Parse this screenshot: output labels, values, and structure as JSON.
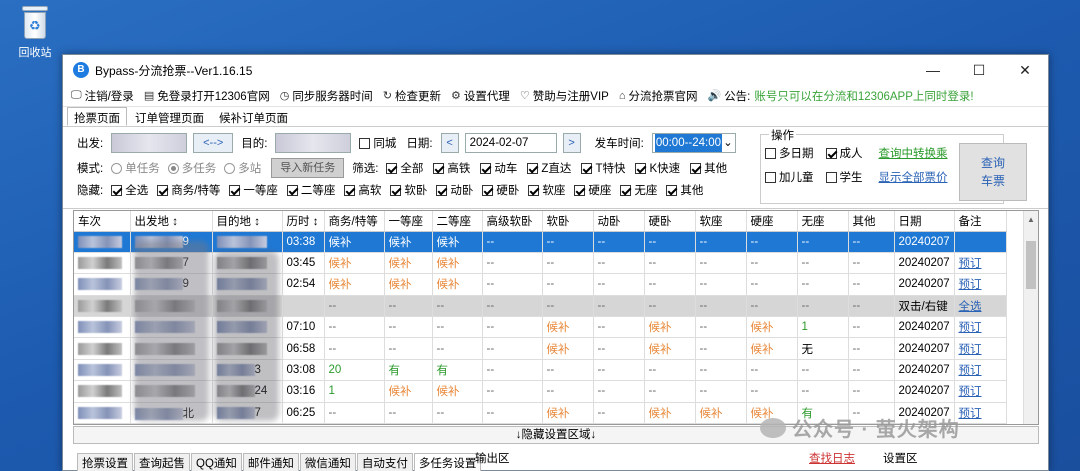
{
  "desktop": {
    "recycle_bin_label": "回收站"
  },
  "window": {
    "title": "Bypass-分流抢票--Ver1.16.15",
    "min": "—",
    "max": "☐",
    "close": "✕"
  },
  "menu": {
    "items": [
      {
        "icon": "🖵",
        "label": "注销/登录"
      },
      {
        "icon": "▤",
        "label": "免登录打开12306官网"
      },
      {
        "icon": "◷",
        "label": "同步服务器时间"
      },
      {
        "icon": "↻",
        "label": "检查更新"
      },
      {
        "icon": "⚙",
        "label": "设置代理"
      },
      {
        "icon": "♡",
        "label": "赞助与注册VIP"
      },
      {
        "icon": "⌂",
        "label": "分流抢票官网"
      },
      {
        "icon": "🔊",
        "label": "公告:"
      }
    ],
    "notice": "账号只可以在分流和12306APP上同时登录!"
  },
  "tabs": [
    "抢票页面",
    "订单管理页面",
    "候补订单页面"
  ],
  "query": {
    "from_label": "出发:",
    "swap": "<-->",
    "to_label": "目的:",
    "same_city": "同城",
    "date_label": "日期:",
    "date": "2024-02-07",
    "prev": "<",
    "next": ">",
    "time_label": "发车时间:",
    "time": "00:00--24:00",
    "mode_label": "模式:",
    "mode_single": "单任务",
    "mode_multi": "多任务",
    "mode_multi_station": "多站",
    "import_btn": "导入新任务",
    "filter_label": "筛选:",
    "filters": [
      "全部",
      "高铁",
      "动车",
      "Z直达",
      "T特快",
      "K快速",
      "其他"
    ],
    "hide_label": "隐藏:",
    "hides": [
      "全选",
      "商务/特等",
      "一等座",
      "二等座",
      "高软",
      "软卧",
      "动卧",
      "硬卧",
      "软座",
      "硬座",
      "无座",
      "其他"
    ]
  },
  "ops": {
    "title": "操作",
    "multi_date": "多日期",
    "adult": "成人",
    "transfer_link": "查询中转换乘",
    "add_child": "加儿童",
    "student": "学生",
    "show_all_link": "显示全部票价",
    "query_btn_l1": "查询",
    "query_btn_l2": "车票"
  },
  "grid": {
    "headers": [
      "车次",
      "出发地 ↕",
      "目的地 ↕",
      "历时 ↕",
      "商务/特等",
      "一等座",
      "二等座",
      "高级软卧",
      "软卧",
      "动卧",
      "硬卧",
      "软座",
      "硬座",
      "无座",
      "其他",
      "日期",
      "备注"
    ],
    "rows": [
      {
        "sel": true,
        "c": [
          "",
          "9",
          "",
          "03:38",
          "候补",
          "候补",
          "候补",
          "--",
          "--",
          "--",
          "--",
          "--",
          "--",
          "--",
          "--",
          "20240207",
          ""
        ]
      },
      {
        "c": [
          "",
          "7",
          "",
          "03:45",
          "候补",
          "候补",
          "候补",
          "--",
          "--",
          "--",
          "--",
          "--",
          "--",
          "--",
          "--",
          "20240207",
          "预订"
        ]
      },
      {
        "c": [
          "",
          "9",
          "",
          "02:54",
          "候补",
          "候补",
          "候补",
          "--",
          "--",
          "--",
          "--",
          "--",
          "--",
          "--",
          "--",
          "20240207",
          "预订"
        ]
      },
      {
        "grey": true,
        "c": [
          "",
          "",
          "",
          "",
          "--",
          "--",
          "--",
          "--",
          "--",
          "--",
          "--",
          "--",
          "--",
          "--",
          "--",
          "双击/右键",
          "全选"
        ]
      },
      {
        "c": [
          "",
          "",
          "",
          "07:10",
          "--",
          "--",
          "--",
          "--",
          "候补",
          "--",
          "候补",
          "--",
          "候补",
          "1",
          "--",
          "20240207",
          "预订"
        ]
      },
      {
        "c": [
          "",
          "",
          "",
          "06:58",
          "--",
          "--",
          "--",
          "--",
          "候补",
          "--",
          "候补",
          "--",
          "候补",
          "无",
          "--",
          "20240207",
          "预订"
        ]
      },
      {
        "c": [
          "",
          "",
          "3",
          "03:08",
          "20",
          "有",
          "有",
          "--",
          "--",
          "--",
          "--",
          "--",
          "--",
          "--",
          "--",
          "20240207",
          "预订"
        ]
      },
      {
        "c": [
          "",
          "",
          "24",
          "03:16",
          "1",
          "候补",
          "候补",
          "--",
          "--",
          "--",
          "--",
          "--",
          "--",
          "--",
          "--",
          "20240207",
          "预订"
        ]
      },
      {
        "c": [
          "",
          "北",
          "7",
          "06:25",
          "--",
          "--",
          "--",
          "--",
          "候补",
          "--",
          "候补",
          "候补",
          "候补",
          "有",
          "--",
          "20240207",
          "预订"
        ]
      }
    ]
  },
  "hide_settings": "↓隐藏设置区域↓",
  "bottom_tabs": [
    "抢票设置",
    "查询起售",
    "QQ通知",
    "邮件通知",
    "微信通知",
    "自动支付",
    "多任务设置"
  ],
  "output": {
    "label": "输出区",
    "log_link": "查找日志"
  },
  "settings": {
    "label": "设置区"
  },
  "watermark": "公众号 · 萤火架构"
}
